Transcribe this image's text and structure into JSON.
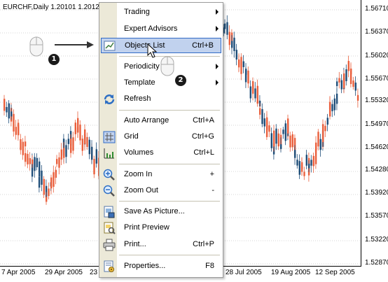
{
  "chart": {
    "title": "EURCHF,Daily  1.20101 1.2012",
    "y_labels": [
      "1.56710",
      "1.56370",
      "1.56020",
      "1.55670",
      "1.55320",
      "1.54970",
      "1.54620",
      "1.54280",
      "1.53920",
      "1.53570",
      "1.53220",
      "1.52870"
    ],
    "x_labels": [
      "7 Apr 2005",
      "29 Apr 2005",
      "23",
      "28 Jul 2005",
      "19 Aug 2005",
      "12 Sep 2005"
    ],
    "colors": {
      "bull": "#1f4e79",
      "bear": "#ea5f3c",
      "grid": "#d4d4d4"
    }
  },
  "menu": {
    "items": [
      {
        "label": "Trading",
        "shortcut": "",
        "submenu": true,
        "icon": ""
      },
      {
        "label": "Expert Advisors",
        "shortcut": "",
        "submenu": true,
        "icon": ""
      },
      {
        "label": "Objects List",
        "shortcut": "Ctrl+B",
        "submenu": false,
        "icon": "objects-list-icon",
        "highlighted": true
      },
      {
        "label": "Periodicity",
        "shortcut": "",
        "submenu": true,
        "icon": ""
      },
      {
        "label": "Template",
        "shortcut": "",
        "submenu": true,
        "icon": ""
      },
      {
        "label": "Refresh",
        "shortcut": "",
        "submenu": false,
        "icon": "refresh-icon"
      },
      {
        "label": "Auto Arrange",
        "shortcut": "Ctrl+A",
        "submenu": false,
        "icon": ""
      },
      {
        "label": "Grid",
        "shortcut": "Ctrl+G",
        "submenu": false,
        "icon": "grid-icon"
      },
      {
        "label": "Volumes",
        "shortcut": "Ctrl+L",
        "submenu": false,
        "icon": "volumes-icon"
      },
      {
        "label": "Zoom In",
        "shortcut": "+",
        "submenu": false,
        "icon": "zoom-in-icon"
      },
      {
        "label": "Zoom Out",
        "shortcut": "-",
        "submenu": false,
        "icon": "zoom-out-icon"
      },
      {
        "label": "Save As Picture...",
        "shortcut": "",
        "submenu": false,
        "icon": "save-picture-icon"
      },
      {
        "label": "Print Preview",
        "shortcut": "",
        "submenu": false,
        "icon": "print-preview-icon"
      },
      {
        "label": "Print...",
        "shortcut": "Ctrl+P",
        "submenu": false,
        "icon": "print-icon"
      },
      {
        "label": "Properties...",
        "shortcut": "F8",
        "submenu": false,
        "icon": "properties-icon"
      }
    ]
  },
  "annotations": {
    "step1": "1",
    "step2": "2"
  }
}
